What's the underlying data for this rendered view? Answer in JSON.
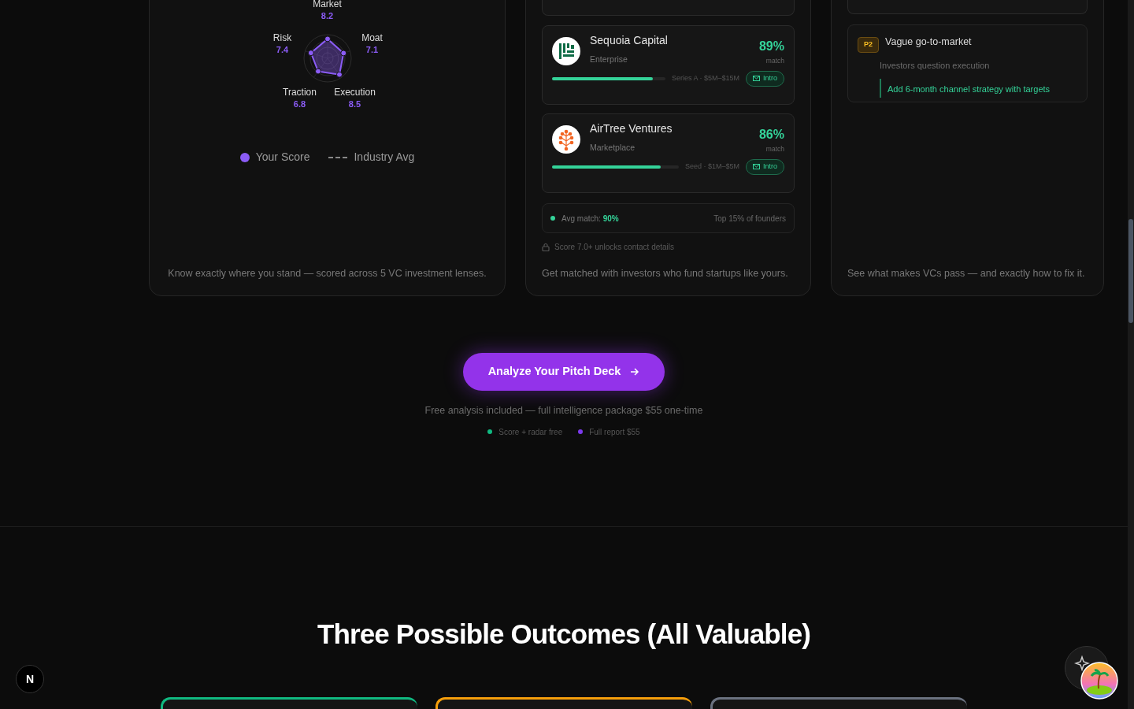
{
  "score_card": {
    "axes": [
      {
        "label": "Market",
        "score": "8.2"
      },
      {
        "label": "Risk",
        "score": "7.4"
      },
      {
        "label": "Moat",
        "score": "7.1"
      },
      {
        "label": "Traction",
        "score": "6.8"
      },
      {
        "label": "Execution",
        "score": "8.5"
      }
    ],
    "legend": [
      {
        "kind": "dot",
        "label": "Your Score"
      },
      {
        "kind": "dash",
        "label": "Industry Avg"
      }
    ],
    "caption": "Know exactly where you stand — scored across 5 VC investment lenses."
  },
  "investor_card": {
    "matches": [
      {
        "name": "Sequoia Capital",
        "sector": "Enterprise",
        "match": "89%",
        "match_label": "match",
        "level": 0.89,
        "stage": "Series A · $5M–$15M",
        "action": "Intro"
      },
      {
        "name": "AirTree Ventures",
        "sector": "Marketplace",
        "match": "86%",
        "match_label": "match",
        "level": 0.86,
        "stage": "Seed · $1M–$5M",
        "action": "Intro"
      }
    ],
    "summary": {
      "label": "Avg match:",
      "value": "90%",
      "rank": "Top 15% of founders"
    },
    "lock_note": "Score 7.0+ unlocks contact details",
    "caption": "Get matched with investors who fund startups like yours."
  },
  "issues_card": {
    "issues": [
      {
        "priority": "P2",
        "title": "Vague go-to-market",
        "impact": "Investors question execution",
        "fix": "Add 6-month channel strategy with targets"
      }
    ],
    "caption": "See what makes VCs pass — and exactly how to fix it."
  },
  "cta": {
    "button": "Analyze Your Pitch Deck",
    "note": "Free analysis included — full intelligence package $55 one-time",
    "tags": [
      {
        "label": "Score + radar free",
        "color": "#10b981"
      },
      {
        "label": "Full report $55",
        "color": "#7c3aed"
      }
    ]
  },
  "outcomes": {
    "heading": "Three Possible Outcomes (All Valuable)",
    "cards": [
      {
        "color": "#10b981"
      },
      {
        "color": "#f59e0b"
      },
      {
        "color": "#6b7280"
      }
    ]
  },
  "dev_badge": {
    "letter": "N"
  }
}
